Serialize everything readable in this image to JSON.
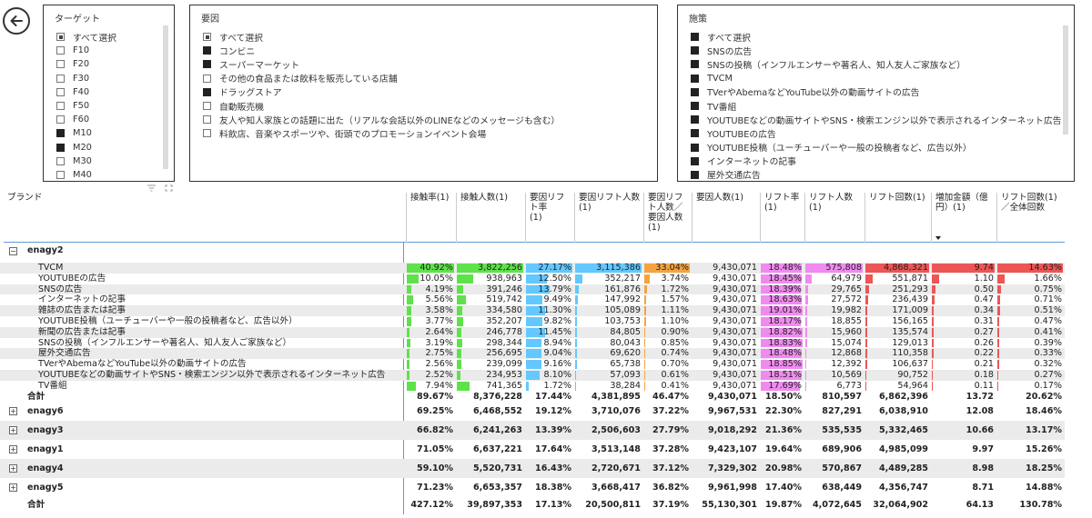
{
  "filters": {
    "target": {
      "title": "ターゲット",
      "items": [
        {
          "label": "すべて選択",
          "state": "partial"
        },
        {
          "label": "F10",
          "state": "off"
        },
        {
          "label": "F20",
          "state": "off"
        },
        {
          "label": "F30",
          "state": "off"
        },
        {
          "label": "F40",
          "state": "off"
        },
        {
          "label": "F50",
          "state": "off"
        },
        {
          "label": "F60",
          "state": "off"
        },
        {
          "label": "M10",
          "state": "on"
        },
        {
          "label": "M20",
          "state": "on"
        },
        {
          "label": "M30",
          "state": "off"
        },
        {
          "label": "M40",
          "state": "off"
        }
      ]
    },
    "factor": {
      "title": "要因",
      "items": [
        {
          "label": "すべて選択",
          "state": "partial"
        },
        {
          "label": "コンビニ",
          "state": "on"
        },
        {
          "label": "スーパーマーケット",
          "state": "on"
        },
        {
          "label": "その他の食品または飲料を販売している店舗",
          "state": "off"
        },
        {
          "label": "ドラッグストア",
          "state": "on"
        },
        {
          "label": "自動販売機",
          "state": "off"
        },
        {
          "label": "友人や知人家族との話題に出た（リアルな会話以外のLINEなどのメッセージも含む）",
          "state": "off"
        },
        {
          "label": "料飲店、音楽やスポーツや、街頭でのプロモーションイベント会場",
          "state": "off"
        }
      ]
    },
    "measure": {
      "title": "施策",
      "items": [
        {
          "label": "すべて選択",
          "state": "on"
        },
        {
          "label": "SNSの広告",
          "state": "on"
        },
        {
          "label": "SNSの投稿（インフルエンサーや著名人、知人友人ご家族など）",
          "state": "on"
        },
        {
          "label": "TVCM",
          "state": "on"
        },
        {
          "label": "TVerやAbemaなどYouTube以外の動画サイトの広告",
          "state": "on"
        },
        {
          "label": "TV番組",
          "state": "on"
        },
        {
          "label": "YOUTUBEなどの動画サイトやSNS・検索エンジン以外で表示されるインターネット広告",
          "state": "on"
        },
        {
          "label": "YOUTUBEの広告",
          "state": "on"
        },
        {
          "label": "YOUTUBE投稿（ユーチューバーや一般の投稿者など、広告以外）",
          "state": "on"
        },
        {
          "label": "インターネットの記事",
          "state": "on"
        },
        {
          "label": "屋外交通広告",
          "state": "on"
        }
      ]
    }
  },
  "table": {
    "headers": [
      "ブランド",
      "接触率(1)",
      "接触人数(1)",
      "要因リフト率\n(1)",
      "要因リフト人数(1)",
      "要因リフト人数／要因人数(1)",
      "要因人数(1)",
      "リフト率(1)",
      "リフト人数(1)",
      "リフト回数(1)",
      "増加金額（億円）(1)",
      "リフト回数(1)／全体回数"
    ],
    "colors": {
      "green": "#5ee24a",
      "cyan": "#62c8ff",
      "orange": "#f5a340",
      "pink": "#f08af0",
      "red": "#ee5555"
    },
    "expanded_brand": "enagy2",
    "detail_rows": [
      [
        "TVCM",
        "40.92%",
        "3,822,256",
        "27.17%",
        "3,115,386",
        "33.04%",
        "9,430,071",
        "18.48%",
        "575,808",
        "4,868,321",
        "9.74",
        "14.63%"
      ],
      [
        "YOUTUBEの広告",
        "10.05%",
        "938,963",
        "12.50%",
        "352,217",
        "3.74%",
        "9,430,071",
        "18.45%",
        "64,979",
        "551,871",
        "1.10",
        "1.66%"
      ],
      [
        "SNSの広告",
        "4.19%",
        "391,246",
        "13.79%",
        "161,876",
        "1.72%",
        "9,430,071",
        "18.39%",
        "29,765",
        "251,293",
        "0.50",
        "0.75%"
      ],
      [
        "インターネットの記事",
        "5.56%",
        "519,742",
        "9.49%",
        "147,992",
        "1.57%",
        "9,430,071",
        "18.63%",
        "27,572",
        "236,439",
        "0.47",
        "0.71%"
      ],
      [
        "雑誌の広告または記事",
        "3.58%",
        "334,580",
        "11.30%",
        "105,089",
        "1.11%",
        "9,430,071",
        "19.01%",
        "19,982",
        "171,009",
        "0.34",
        "0.51%"
      ],
      [
        "YOUTUBE投稿（ユーチューバーや一般の投稿者など、広告以外）",
        "3.77%",
        "352,207",
        "9.82%",
        "103,753",
        "1.10%",
        "9,430,071",
        "18.17%",
        "18,855",
        "156,165",
        "0.31",
        "0.47%"
      ],
      [
        "新聞の広告または記事",
        "2.64%",
        "246,778",
        "11.45%",
        "84,805",
        "0.90%",
        "9,430,071",
        "18.82%",
        "15,960",
        "135,574",
        "0.27",
        "0.41%"
      ],
      [
        "SNSの投稿（インフルエンサーや著名人、知人友人ご家族など）",
        "3.19%",
        "298,344",
        "8.94%",
        "80,043",
        "0.85%",
        "9,430,071",
        "18.83%",
        "15,074",
        "129,013",
        "0.26",
        "0.39%"
      ],
      [
        "屋外交通広告",
        "2.75%",
        "256,695",
        "9.04%",
        "69,620",
        "0.74%",
        "9,430,071",
        "18.48%",
        "12,868",
        "110,358",
        "0.22",
        "0.33%"
      ],
      [
        "TVerやAbemaなどYouTube以外の動画サイトの広告",
        "2.56%",
        "239,099",
        "9.16%",
        "65,738",
        "0.70%",
        "9,430,071",
        "18.85%",
        "12,392",
        "106,637",
        "0.21",
        "0.32%"
      ],
      [
        "YOUTUBEなどの動画サイトやSNS・検索エンジン以外で表示されるインターネット広告",
        "2.52%",
        "234,953",
        "8.10%",
        "57,093",
        "0.61%",
        "9,430,071",
        "18.51%",
        "10,569",
        "90,752",
        "0.18",
        "0.27%"
      ],
      [
        "TV番組",
        "7.94%",
        "741,365",
        "1.72%",
        "38,284",
        "0.41%",
        "9,430,071",
        "17.69%",
        "6,773",
        "54,964",
        "0.11",
        "0.17%"
      ]
    ],
    "subtotal": [
      "合計",
      "89.67%",
      "8,376,228",
      "17.44%",
      "4,381,895",
      "46.47%",
      "9,430,071",
      "18.50%",
      "810,597",
      "6,862,396",
      "13.72",
      "20.62%"
    ],
    "collapsed_rows": [
      [
        "enagy6",
        "69.25%",
        "6,468,552",
        "19.12%",
        "3,710,076",
        "37.22%",
        "9,967,531",
        "22.30%",
        "827,291",
        "6,038,910",
        "12.08",
        "18.46%"
      ],
      [
        "enagy3",
        "66.82%",
        "6,241,263",
        "13.39%",
        "2,506,603",
        "27.79%",
        "9,018,292",
        "21.36%",
        "535,535",
        "5,332,465",
        "10.66",
        "13.17%"
      ],
      [
        "enagy1",
        "71.05%",
        "6,637,221",
        "17.64%",
        "3,513,148",
        "37.28%",
        "9,423,107",
        "19.64%",
        "689,906",
        "4,985,099",
        "9.97",
        "15.26%"
      ],
      [
        "enagy4",
        "59.10%",
        "5,520,731",
        "16.43%",
        "2,720,671",
        "37.12%",
        "7,329,302",
        "20.98%",
        "570,867",
        "4,489,285",
        "8.98",
        "18.25%"
      ],
      [
        "enagy5",
        "71.23%",
        "6,653,357",
        "18.38%",
        "3,668,417",
        "36.82%",
        "9,961,998",
        "17.40%",
        "638,449",
        "4,356,747",
        "8.71",
        "14.88%"
      ]
    ],
    "grand_total": [
      "合計",
      "427.12%",
      "39,897,353",
      "17.13%",
      "20,500,811",
      "37.19%",
      "55,130,301",
      "19.87%",
      "4,072,645",
      "32,064,902",
      "64.13",
      "130.78%"
    ]
  }
}
